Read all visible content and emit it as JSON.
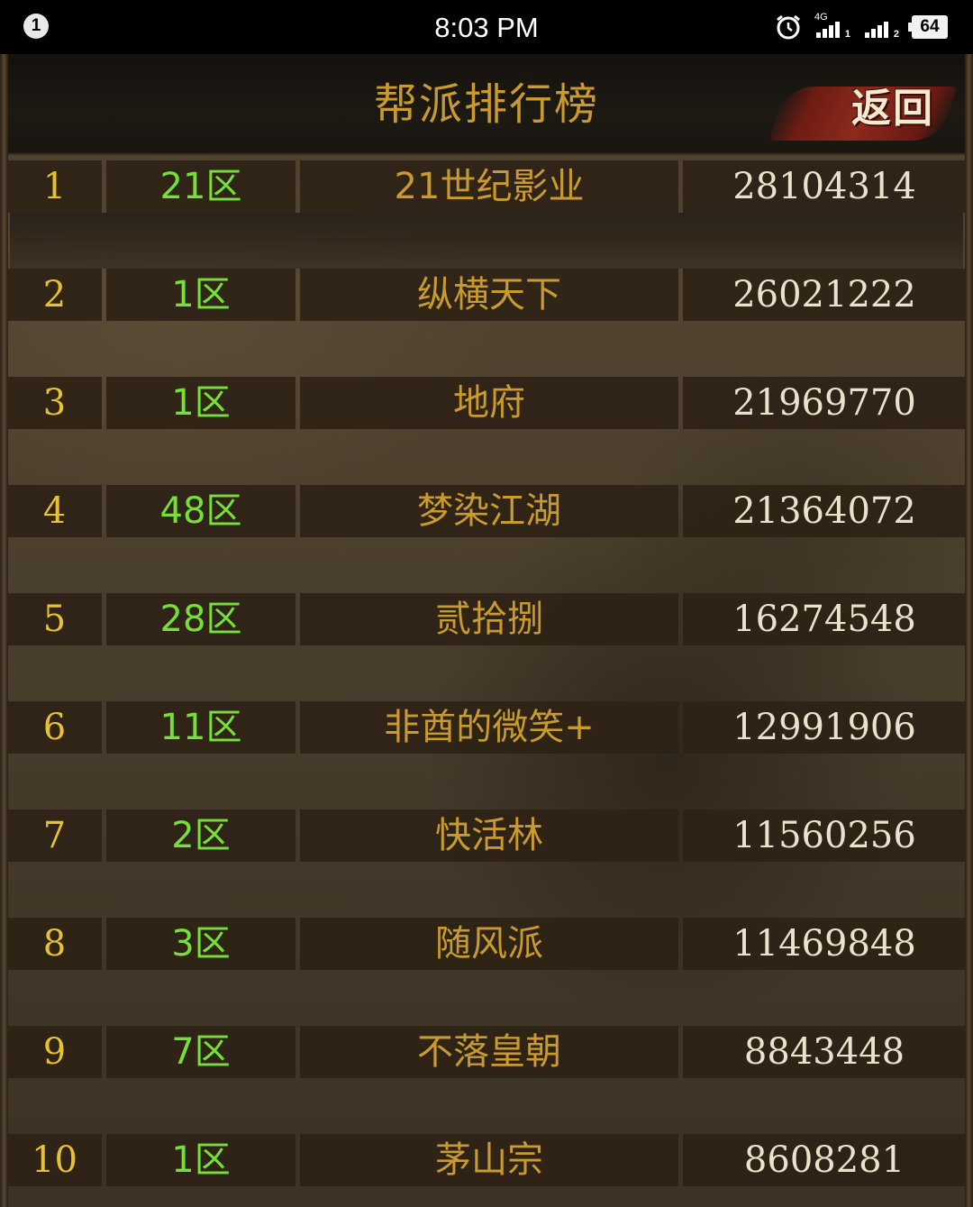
{
  "status_bar": {
    "notification_count": "1",
    "time": "8:03 PM",
    "network_type": "4G",
    "sim1_label": "1",
    "sim2_label": "2",
    "battery": "64"
  },
  "header": {
    "title": "帮派排行榜",
    "back_label": "返回"
  },
  "ranking": [
    {
      "rank": "1",
      "zone": "21区",
      "guild": "21世纪影业",
      "score": "28104314"
    },
    {
      "rank": "2",
      "zone": "1区",
      "guild": "纵横天下",
      "score": "26021222"
    },
    {
      "rank": "3",
      "zone": "1区",
      "guild": "地府",
      "score": "21969770"
    },
    {
      "rank": "4",
      "zone": "48区",
      "guild": "梦染江湖",
      "score": "21364072"
    },
    {
      "rank": "5",
      "zone": "28区",
      "guild": "贰拾捌",
      "score": "16274548"
    },
    {
      "rank": "6",
      "zone": "11区",
      "guild": "非酋的微笑+",
      "score": "12991906"
    },
    {
      "rank": "7",
      "zone": "2区",
      "guild": "快活林",
      "score": "11560256"
    },
    {
      "rank": "8",
      "zone": "3区",
      "guild": "随风派",
      "score": "11469848"
    },
    {
      "rank": "9",
      "zone": "7区",
      "guild": "不落皇朝",
      "score": "8843448"
    },
    {
      "rank": "10",
      "zone": "1区",
      "guild": "茅山宗",
      "score": "8608281"
    }
  ],
  "colors": {
    "title": "#c99a2e",
    "rank": "#e6c231",
    "zone": "#75e036",
    "guild": "#c99a2e",
    "score": "#ece2cc"
  }
}
